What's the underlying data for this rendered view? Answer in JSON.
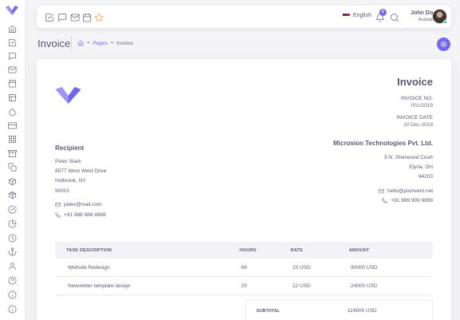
{
  "sidebar": {
    "icons": [
      "home-icon",
      "check-square-icon",
      "message-square-icon",
      "mail-icon",
      "calendar-icon",
      "layout-icon",
      "droplet-icon",
      "credit-card-icon",
      "grid-icon",
      "archive-icon",
      "copy-icon",
      "box-icon",
      "package-icon",
      "check-circle-icon",
      "pie-chart-icon",
      "clock-icon",
      "anchor-icon",
      "user-icon",
      "help-circle-icon",
      "info-icon"
    ]
  },
  "navbar": {
    "language": "English",
    "notification_count": "5",
    "user_name": "John Doe",
    "user_status": "Available"
  },
  "header": {
    "title": "Invoice",
    "breadcrumb": {
      "pages": "Pages",
      "current": "Invoice"
    }
  },
  "invoice": {
    "title": "Invoice",
    "number_label": "INVOICE NO.",
    "number": "001/2019",
    "date_label": "INVOICE DATE",
    "date": "10 Dec 2018",
    "recipient": {
      "heading": "Recipient",
      "name": "Peter Stark",
      "street": "8577 West West Drive",
      "city": "Holbrook, NY",
      "zip": "90001",
      "email": "peter@mail.com",
      "phone": "+91 988 888 8888"
    },
    "company": {
      "name": "Microsion Technologies Pvt. Ltd.",
      "street": "9 N. Sherwood Court",
      "city": "Elyria, OH",
      "zip": "94203",
      "email": "hello@pixinvent.net",
      "phone": "+91 999 999 9999"
    },
    "table": {
      "headers": [
        "TASK DESCRIPTION",
        "HOURS",
        "RATE",
        "AMOUNT"
      ],
      "rows": [
        [
          "Website Redesign",
          "60",
          "15 USD",
          "90000 USD"
        ],
        [
          "Newsletter template design",
          "20",
          "12 USD",
          "24000 USD"
        ]
      ]
    },
    "subtotal_label": "SUBTOTAL",
    "subtotal_value": "114000 USD"
  },
  "colors": {
    "primary": "#7367f0",
    "star": "#ff9f43",
    "online": "#28c76f"
  }
}
